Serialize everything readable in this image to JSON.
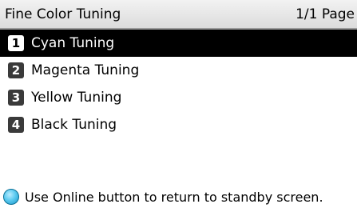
{
  "header": {
    "title": "Fine Color Tuning",
    "page_indicator": "1/1 Page"
  },
  "menu": {
    "items": [
      {
        "number": "1",
        "label": "Cyan Tuning",
        "selected": true
      },
      {
        "number": "2",
        "label": "Magenta Tuning",
        "selected": false
      },
      {
        "number": "3",
        "label": "Yellow Tuning",
        "selected": false
      },
      {
        "number": "4",
        "label": "Black Tuning",
        "selected": false
      }
    ]
  },
  "footer": {
    "icon": "online-button-icon",
    "message": "Use Online button to return to standby screen."
  },
  "colors": {
    "header_background": "#e6e6e6",
    "selection_background": "#000000",
    "selection_text": "#ffffff",
    "number_badge": "#3a3a3a",
    "online_icon": "#3cb4e6"
  }
}
